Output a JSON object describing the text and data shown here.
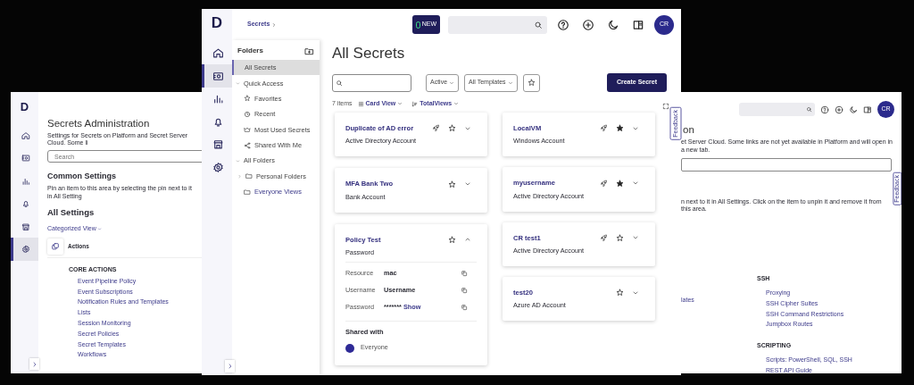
{
  "left_window": {
    "logo": "D",
    "nav": [
      {
        "kind": "home",
        "selected": false
      },
      {
        "kind": "vault",
        "selected": false
      },
      {
        "kind": "chart",
        "selected": false
      },
      {
        "kind": "bell",
        "selected": false
      },
      {
        "kind": "store",
        "selected": false
      },
      {
        "kind": "gear",
        "selected": true
      }
    ],
    "title": "Secrets Administration",
    "description": "Settings for Secrets on Platform and Secret Server Cloud. Some li",
    "search": {
      "placeholder": "Search"
    },
    "common_heading": "Common Settings",
    "common_hint": "Pin an item to this area by selecting the pin next to it in All Setting",
    "all_heading": "All Settings",
    "view_toggle": "Categorized View",
    "category": "Actions",
    "group_heading": "CORE ACTIONS",
    "links": [
      "Event Pipeline Policy",
      "Event Subscriptions",
      "Notification Rules and Templates",
      "Lists",
      "Session Monitoring",
      "Secret Policies",
      "Secret Templates",
      "Workflows"
    ]
  },
  "right_window": {
    "avatar": "CR",
    "title_fragment": "on",
    "description": "et Server Cloud. Some links are not yet available in Platform and will open in a new tab.",
    "hint": "n next to it in All Settings. Click on the item to unpin it and remove it from this area.",
    "link_fragment": "lates",
    "feedback": "Feedback",
    "groups": [
      {
        "heading": "SSH",
        "links": [
          "Proxying",
          "SSH Cipher Suites",
          "SSH Command Restrictions",
          "Jumpbox Routes"
        ]
      },
      {
        "heading": "SCRIPTING",
        "links": [
          "Scripts: PowerShell, SQL, SSH",
          "REST API Guide"
        ]
      }
    ]
  },
  "main_window": {
    "logo": "D",
    "breadcrumb": "Secrets",
    "new_badge": "NEW",
    "avatar": "CR",
    "feedback": "Feedback",
    "nav": [
      {
        "kind": "home",
        "selected": false
      },
      {
        "kind": "vault",
        "selected": true
      },
      {
        "kind": "chart",
        "selected": false
      },
      {
        "kind": "bell",
        "selected": false
      },
      {
        "kind": "store",
        "selected": false
      },
      {
        "kind": "gear",
        "selected": false
      }
    ],
    "folders": {
      "title": "Folders",
      "items": [
        {
          "label": "All Secrets",
          "selected": true
        },
        {
          "label": "Quick Access",
          "selected": false,
          "expanded": true,
          "children": [
            {
              "label": "Favorites",
              "kind": "star",
              "selected": false
            },
            {
              "label": "Recent",
              "kind": "clock",
              "selected": false
            },
            {
              "label": "Most Used Secrets",
              "kind": "crown",
              "selected": false
            },
            {
              "label": "Shared With Me",
              "kind": "share",
              "selected": false
            }
          ]
        },
        {
          "label": "All Folders",
          "selected": false,
          "expanded": true,
          "children": [
            {
              "label": "Personal Folders",
              "kind": "folder",
              "selected": false,
              "expanded": false
            },
            {
              "label": "Everyone Views",
              "kind": "folder",
              "selected": false
            }
          ]
        }
      ]
    },
    "title": "All Secrets",
    "filters": [
      "Active",
      "All Templates"
    ],
    "create_button": "Create Secret",
    "count": "7 items",
    "view": "Card View",
    "sort": "TotalViews",
    "columns": [
      [
        {
          "title": "Duplicate of AD error",
          "type": "Active Directory Account",
          "launcher": true,
          "favorite": false,
          "expanded": false
        },
        {
          "title": "MFA Bank Two",
          "type": "Bank Account",
          "launcher": false,
          "favorite": false,
          "expanded": false
        },
        {
          "title": "Policy Test",
          "type": "Password",
          "launcher": false,
          "favorite": false,
          "expanded": true,
          "fields": [
            {
              "label": "Resource",
              "value": "mac"
            },
            {
              "label": "Username",
              "value": "Username"
            },
            {
              "label": "Password",
              "value": "*******",
              "action": "Show"
            }
          ],
          "shared_heading": "Shared with",
          "shared": [
            {
              "name": "Everyone",
              "color": "#2e2a96"
            }
          ]
        }
      ],
      [
        {
          "title": "LocalVM",
          "type": "Windows Account",
          "launcher": true,
          "favorite": true,
          "expanded": false
        },
        {
          "title": "myusername",
          "type": "Active Directory Account",
          "launcher": true,
          "favorite": true,
          "expanded": false
        },
        {
          "title": "CR test1",
          "type": "Active Directory Account",
          "launcher": true,
          "favorite": false,
          "expanded": false
        },
        {
          "title": "test20",
          "type": "Azure AD Account",
          "launcher": false,
          "favorite": false,
          "expanded": false
        }
      ]
    ]
  }
}
